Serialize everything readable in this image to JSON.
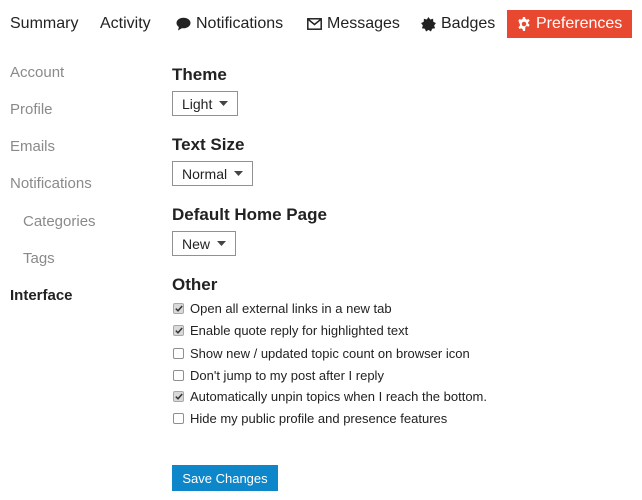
{
  "nav": {
    "tabs": [
      {
        "label": "Summary",
        "icon": ""
      },
      {
        "label": "Activity",
        "icon": ""
      },
      {
        "label": "Notifications",
        "icon": "speech-bubble-icon"
      },
      {
        "label": "Messages",
        "icon": "envelope-icon"
      },
      {
        "label": "Badges",
        "icon": "badge-icon"
      },
      {
        "label": "Preferences",
        "icon": "gear-icon",
        "active": true
      }
    ]
  },
  "sidebar": {
    "items": [
      {
        "label": "Account"
      },
      {
        "label": "Profile"
      },
      {
        "label": "Emails"
      },
      {
        "label": "Notifications"
      },
      {
        "label": "Categories",
        "indent": true
      },
      {
        "label": "Tags",
        "indent": true
      },
      {
        "label": "Interface",
        "active": true
      }
    ]
  },
  "main": {
    "theme": {
      "title": "Theme",
      "value": "Light"
    },
    "text_size": {
      "title": "Text Size",
      "value": "Normal"
    },
    "home_page": {
      "title": "Default Home Page",
      "value": "New"
    },
    "other": {
      "title": "Other",
      "options": [
        {
          "label": "Open all external links in a new tab",
          "checked": true
        },
        {
          "label": "Enable quote reply for highlighted text",
          "checked": true
        },
        {
          "label": "Show new / updated topic count on browser icon",
          "checked": false
        },
        {
          "label": "Don't jump to my post after I reply",
          "checked": false
        },
        {
          "label": "Automatically unpin topics when I reach the bottom.",
          "checked": true
        },
        {
          "label": "Hide my public profile and presence features",
          "checked": false
        }
      ]
    },
    "save_label": "Save Changes"
  },
  "colors": {
    "accent": "#e8482f",
    "button": "#0e86ca",
    "muted_text": "#8a8a8a",
    "text": "#222222"
  }
}
